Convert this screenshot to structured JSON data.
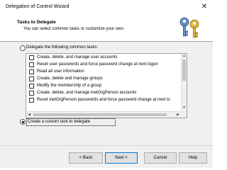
{
  "window": {
    "title": "Delegation of Control Wizard",
    "close_symbol": "✕"
  },
  "header": {
    "title": "Tasks to Delegate",
    "subtitle": "You can select common tasks or customize your own.",
    "icon": "keys-icon"
  },
  "options": {
    "common": {
      "label": "Delegate the following common tasks:",
      "selected": false
    },
    "custom": {
      "label": "Create a custom task to delegate",
      "selected": true
    }
  },
  "tasks": [
    {
      "label": "Create, delete, and manage user accounts",
      "checked": false
    },
    {
      "label": "Reset user passwords and force password change at next logon",
      "checked": false
    },
    {
      "label": "Read all user information",
      "checked": false
    },
    {
      "label": "Create, delete and manage groups",
      "checked": false
    },
    {
      "label": "Modify the membership of a group",
      "checked": false
    },
    {
      "label": "Create, delete, and manage inetOrgPerson accounts",
      "checked": false
    },
    {
      "label": "Reset inetOrgPerson passwords and force password change at next lo",
      "checked": false
    }
  ],
  "buttons": {
    "back": "< Back",
    "next": "Next >",
    "cancel": "Cancel",
    "help": "Help"
  },
  "colors": {
    "accent": "#0078d7",
    "dialog_bg": "#f0f0f0"
  }
}
